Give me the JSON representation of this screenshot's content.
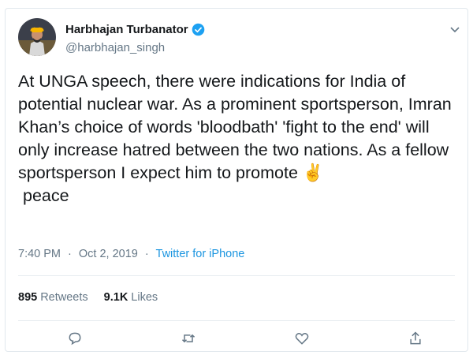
{
  "user": {
    "display_name": "Harbhajan Turbanator",
    "handle": "@harbhajan_singh",
    "verified": true
  },
  "tweet": {
    "text_main": "At UNGA speech, there were indications for India of potential nuclear war. As a prominent sportsperson, Imran Khan’s choice of words 'bloodbath' 'fight to the end' will only increase hatred between the two nations. As a fellow sportsperson I expect him to promote ",
    "emoji": "✌️",
    "text_end": " peace"
  },
  "meta": {
    "time": "7:40 PM",
    "separator": "·",
    "date": "Oct 2, 2019",
    "source": "Twitter for iPhone"
  },
  "stats": {
    "retweets_count": "895",
    "retweets_label": "Retweets",
    "likes_count": "9.1K",
    "likes_label": "Likes"
  },
  "actions": [
    "reply-icon",
    "retweet-icon",
    "like-icon",
    "share-icon"
  ],
  "colors": {
    "link": "#1b95e0",
    "muted": "#657786",
    "verified": "#1da1f2"
  }
}
